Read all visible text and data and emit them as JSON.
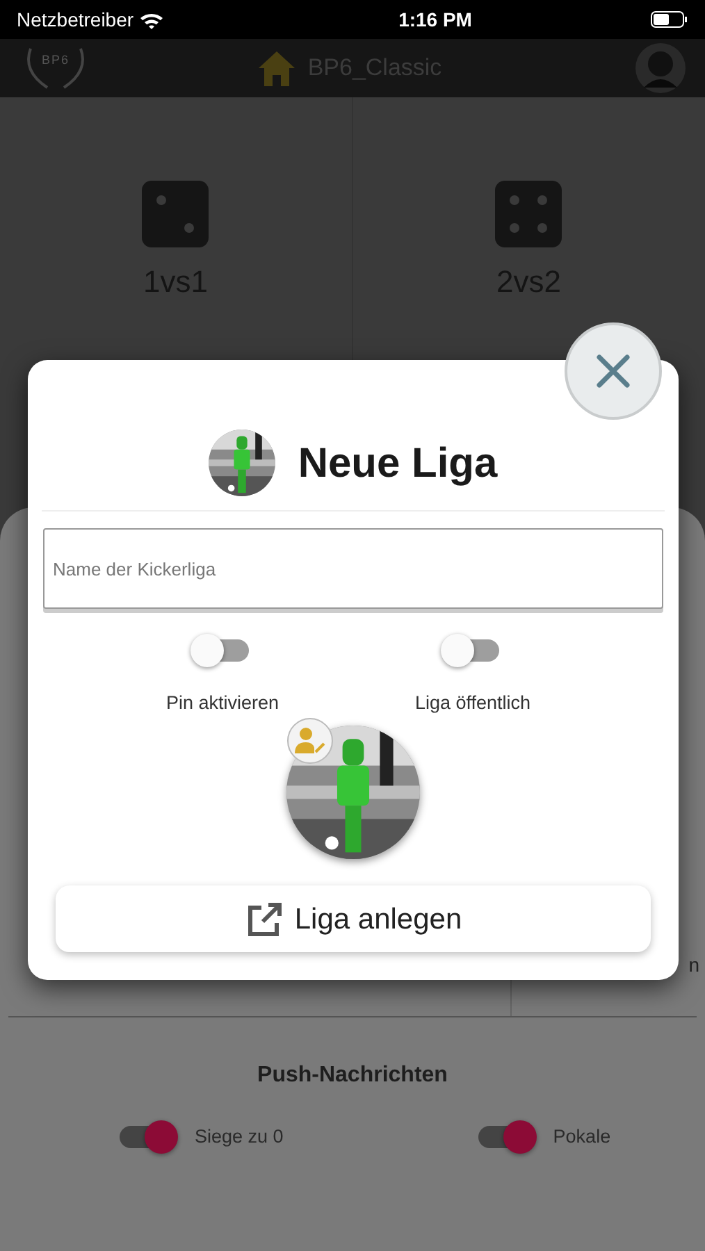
{
  "status_bar": {
    "carrier": "Netzbetreiber",
    "time": "1:16 PM"
  },
  "header": {
    "logo_text": "BP6",
    "title": "BP6_Classic"
  },
  "modes": [
    {
      "label": "1vs1",
      "kind": "two"
    },
    {
      "label": "2vs2",
      "kind": "four"
    }
  ],
  "sheet": {
    "partial_label": "n",
    "push_title": "Push-Nachrichten",
    "push_toggles": [
      {
        "label": "Siege zu 0",
        "on": true
      },
      {
        "label": "Pokale",
        "on": true
      }
    ]
  },
  "dialog": {
    "title": "Neue Liga",
    "name_field": {
      "placeholder": "Name der Kickerliga"
    },
    "toggles": [
      {
        "label": "Pin aktivieren",
        "on": false
      },
      {
        "label": "Liga öffentlich",
        "on": false
      }
    ],
    "button": "Liga anlegen"
  }
}
